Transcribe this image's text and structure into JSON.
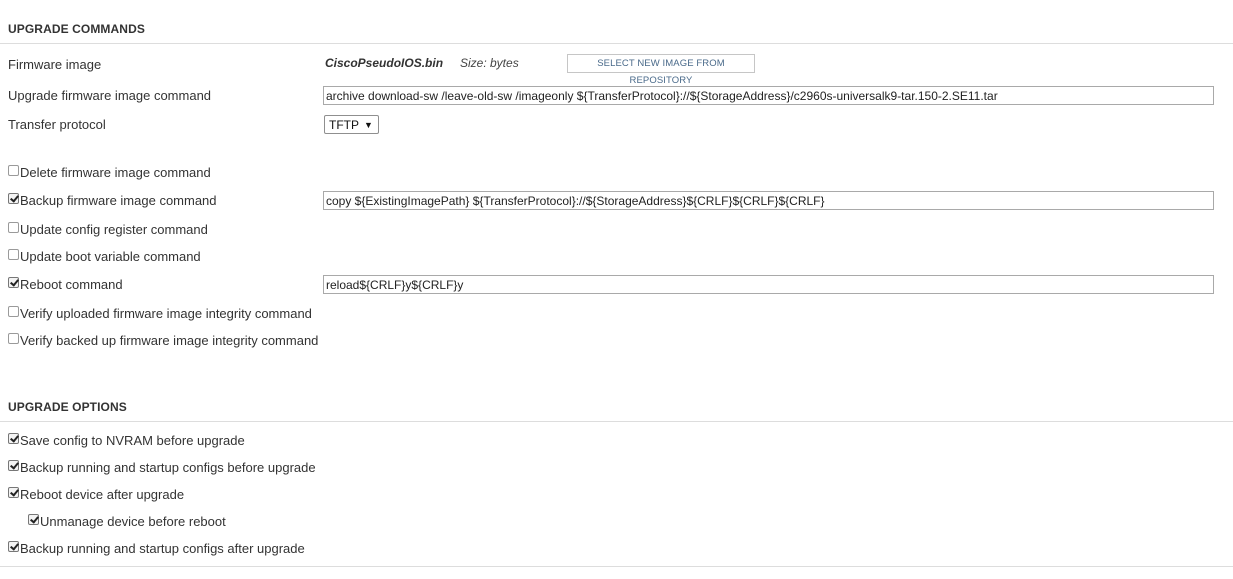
{
  "upgrade_commands": {
    "title": "UPGRADE COMMANDS",
    "firmware_image": {
      "label": "Firmware image",
      "file_name": "CiscoPseudoIOS.bin",
      "size_text": "Size:  bytes",
      "select_button_label": "SELECT NEW IMAGE FROM REPOSITORY"
    },
    "upgrade_command": {
      "label": "Upgrade firmware image command",
      "value": "archive download-sw /leave-old-sw /imageonly ${TransferProtocol}://${StorageAddress}/c2960s-universalk9-tar.150-2.SE11.tar"
    },
    "transfer_protocol": {
      "label": "Transfer protocol",
      "selected": "TFTP",
      "arrow_icon": "triangle-down-icon"
    },
    "checks": {
      "delete": {
        "label": "Delete firmware image command",
        "checked": false
      },
      "backup": {
        "label": "Backup firmware image command",
        "checked": true,
        "value": "copy ${ExistingImagePath} ${TransferProtocol}://${StorageAddress}${CRLF}${CRLF}${CRLF}"
      },
      "config_register": {
        "label": "Update config register command",
        "checked": false
      },
      "boot_variable": {
        "label": "Update boot variable command",
        "checked": false
      },
      "reboot": {
        "label": "Reboot command",
        "checked": true,
        "value": "reload${CRLF}y${CRLF}y"
      },
      "verify_uploaded": {
        "label": "Verify uploaded firmware image integrity command",
        "checked": false
      },
      "verify_backed_up": {
        "label": "Verify backed up firmware image integrity command",
        "checked": false
      }
    }
  },
  "upgrade_options": {
    "title": "UPGRADE OPTIONS",
    "items": {
      "save_config": {
        "label": "Save config to NVRAM before upgrade",
        "checked": true
      },
      "backup_before": {
        "label": "Backup running and startup configs before upgrade",
        "checked": true
      },
      "reboot_after": {
        "label": "Reboot device after upgrade",
        "checked": true
      },
      "unmanage": {
        "label": "Unmanage device before reboot",
        "checked": true
      },
      "backup_after": {
        "label": "Backup running and startup configs after upgrade",
        "checked": true
      }
    }
  }
}
